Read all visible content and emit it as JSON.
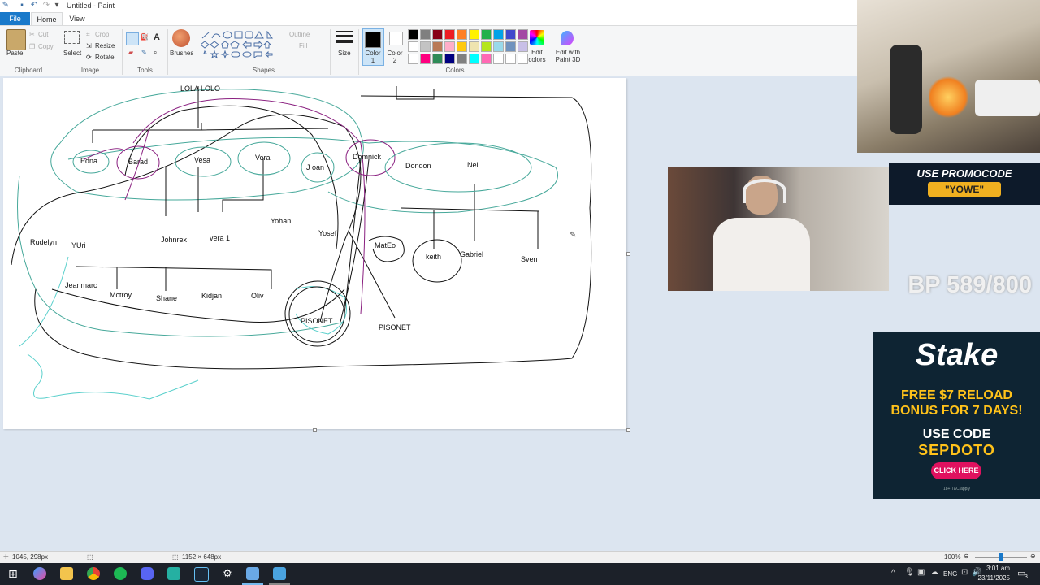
{
  "window": {
    "title": "Untitled - Paint"
  },
  "menu": {
    "file": "File",
    "home": "Home",
    "view": "View"
  },
  "ribbon": {
    "clipboard": {
      "paste": "Paste",
      "cut": "Cut",
      "copy": "Copy",
      "label": "Clipboard"
    },
    "image": {
      "select": "Select",
      "crop": "Crop",
      "resize": "Resize",
      "rotate": "Rotate",
      "label": "Image"
    },
    "tools": {
      "label": "Tools"
    },
    "brushes": {
      "label": "Brushes"
    },
    "shapes": {
      "label": "Shapes",
      "outline": "Outline",
      "fill": "Fill"
    },
    "size": {
      "label": "Size"
    },
    "colors": {
      "color1": "Color 1",
      "color2": "Color 2",
      "label": "Colors",
      "edit": "Edit colors",
      "edit3d": "Edit with Paint 3D",
      "palette": [
        "#000000",
        "#7f7f7f",
        "#880015",
        "#ed1c24",
        "#ff7f27",
        "#fff200",
        "#22b14c",
        "#00a2e8",
        "#3f48cc",
        "#a349a4",
        "#ffffff",
        "#c3c3c3",
        "#b97a57",
        "#ffaec9",
        "#ffc90e",
        "#efe4b0",
        "#b5e61d",
        "#99d9ea",
        "#7092be",
        "#c8bfe7",
        "#ffffff",
        "#ff0080",
        "#2e8b57",
        "#000080",
        "#808080",
        "#00ffff",
        "#ff69b4",
        "#ffffff",
        "#ffffff",
        "#ffffff"
      ]
    }
  },
  "drawing": {
    "names": [
      "LOLA LOLO",
      "Edna",
      "Barad",
      "Vesa",
      "Vera",
      "J oan",
      "Domnick",
      "Dondon",
      "Neil",
      "Yohan",
      "Yosef",
      "Johnrex",
      "vera 1",
      "Rudelyn",
      "YUri",
      "MatEo",
      "keith",
      "Gabriel",
      "Sven",
      "Jeanmarc",
      "Mctroy",
      "Shane",
      "Kidjan",
      "Oliv",
      "PISONET",
      "PISONET"
    ]
  },
  "status": {
    "cursor": "1045, 298px",
    "size": "1152 × 648px",
    "zoom": "100%"
  },
  "taskbar": {
    "lang": "ENG",
    "time": "3:01 am",
    "date": "23/11/2025",
    "notifications": "3"
  },
  "overlay": {
    "promo_line1": "USE PROMOCODE",
    "promo_line2": "\"YOWE\"",
    "bp": "BP 589/800",
    "stake_logo": "Stake",
    "stake_line1": "FREE $7 RELOAD",
    "stake_line2": "BONUS FOR 7 DAYS!",
    "stake_line3": "USE CODE",
    "stake_code": "SEPDOTO",
    "stake_cta": "CLICK HERE",
    "stake_fine": "18+ T&C apply"
  }
}
